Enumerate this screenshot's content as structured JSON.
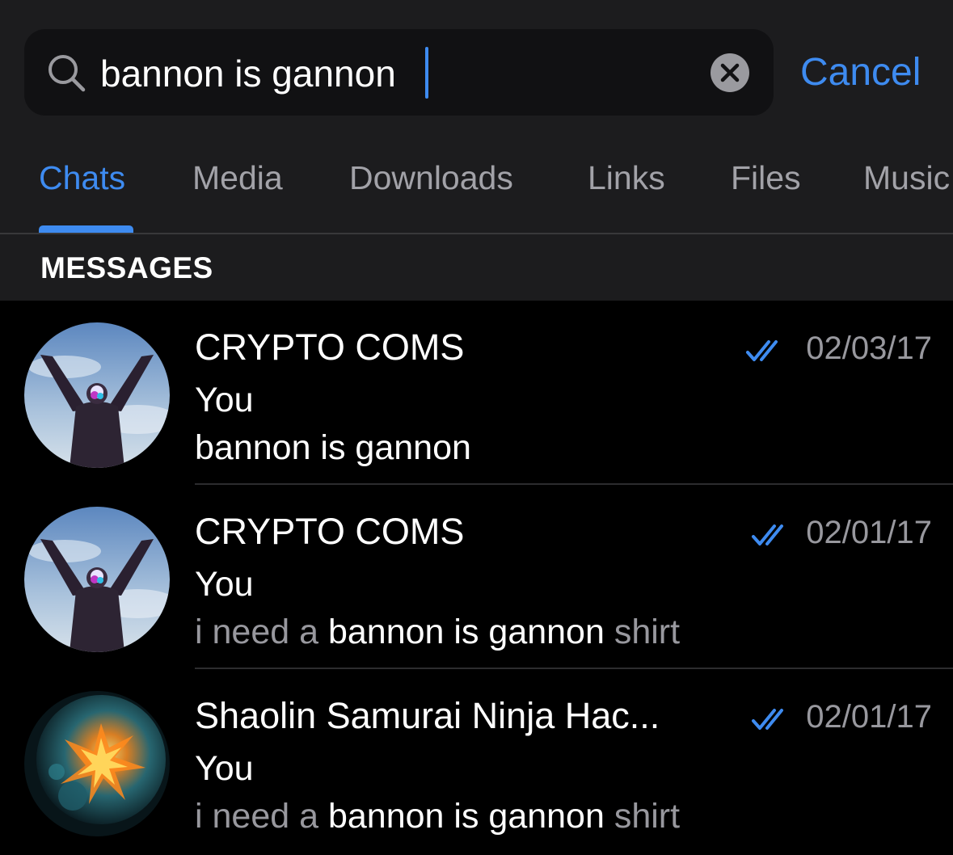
{
  "search": {
    "value": "bannon is gannon",
    "cancel_label": "Cancel",
    "icon": "search-icon",
    "clear_icon": "clear-icon"
  },
  "tabs": [
    {
      "label": "Chats",
      "active": true
    },
    {
      "label": "Media",
      "active": false
    },
    {
      "label": "Downloads",
      "active": false
    },
    {
      "label": "Links",
      "active": false
    },
    {
      "label": "Files",
      "active": false
    },
    {
      "label": "Music",
      "active": false
    }
  ],
  "section": {
    "title": "MESSAGES"
  },
  "results": [
    {
      "title": "CRYPTO COMS",
      "sender": "You",
      "text_before": "",
      "text_match": "bannon is gannon",
      "text_after": "",
      "date": "02/03/17",
      "status_icon": "double-check-icon",
      "avatar": "person-arms-raised-sky"
    },
    {
      "title": "CRYPTO COMS",
      "sender": "You",
      "text_before": "i need a ",
      "text_match": "bannon is gannon",
      "text_after": " shirt",
      "date": "02/01/17",
      "status_icon": "double-check-icon",
      "avatar": "person-arms-raised-sky"
    },
    {
      "title": "Shaolin Samurai Ninja Hac...",
      "sender": "You",
      "text_before": "i need a ",
      "text_match": "bannon is gannon",
      "text_after": " shirt",
      "date": "02/01/17",
      "status_icon": "double-check-icon",
      "avatar": "fiery-burst-abstract"
    }
  ],
  "colors": {
    "accent": "#3e8bf0",
    "header_bg": "#1c1c1e",
    "list_bg": "#000000",
    "secondary_text": "#98989e"
  }
}
